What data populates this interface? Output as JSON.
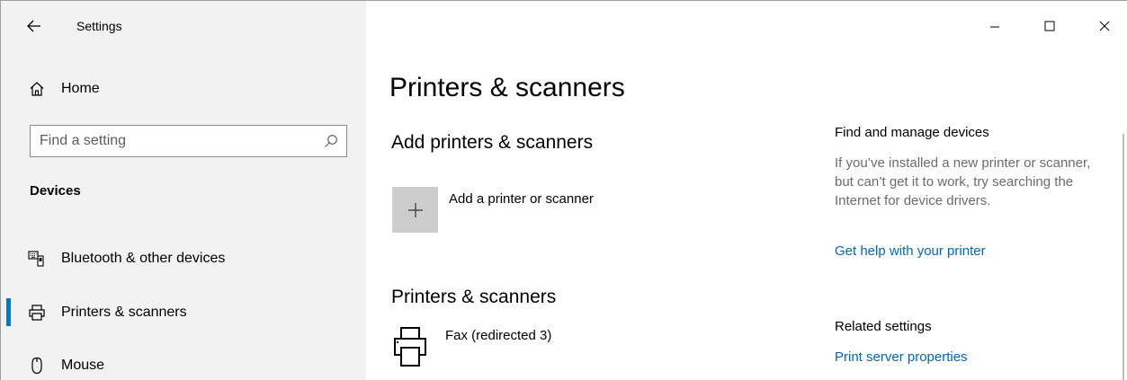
{
  "app": {
    "title": "Settings"
  },
  "window_controls": {
    "minimize": "–",
    "maximize": "□",
    "close": "✕"
  },
  "sidebar": {
    "home": {
      "label": "Home",
      "icon": "home-icon"
    },
    "search": {
      "placeholder": "Find a setting",
      "icon": "search-icon"
    },
    "section": "Devices",
    "items": [
      {
        "label": "Bluetooth & other devices",
        "icon": "bluetooth-devices-icon",
        "active": false
      },
      {
        "label": "Printers & scanners",
        "icon": "printer-icon",
        "active": true
      },
      {
        "label": "Mouse",
        "icon": "mouse-icon",
        "active": false
      }
    ]
  },
  "main": {
    "title": "Printers & scanners",
    "add_section": {
      "heading": "Add printers & scanners",
      "button_label": "Add a printer or scanner"
    },
    "printers_section": {
      "heading": "Printers & scanners",
      "printers": [
        {
          "name": "Fax (redirected 3)"
        }
      ]
    }
  },
  "right_panel": {
    "find_heading": "Find and manage devices",
    "find_text": "If you’ve installed a new printer or scanner, but can’t get it to work, try searching the Internet for device drivers.",
    "help_link": "Get help with your printer",
    "related_heading": "Related settings",
    "related_link": "Print server properties"
  },
  "colors": {
    "accent": "#0078d4",
    "link": "#0067c0",
    "sidebar_bg": "#f2f2f2"
  }
}
